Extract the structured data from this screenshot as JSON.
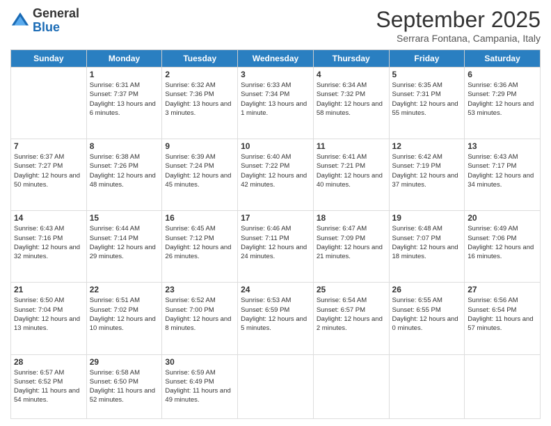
{
  "header": {
    "logo_general": "General",
    "logo_blue": "Blue",
    "month_title": "September 2025",
    "subtitle": "Serrara Fontana, Campania, Italy"
  },
  "days_of_week": [
    "Sunday",
    "Monday",
    "Tuesday",
    "Wednesday",
    "Thursday",
    "Friday",
    "Saturday"
  ],
  "weeks": [
    [
      {
        "day": "",
        "content": ""
      },
      {
        "day": "1",
        "content": "Sunrise: 6:31 AM\nSunset: 7:37 PM\nDaylight: 13 hours\nand 6 minutes."
      },
      {
        "day": "2",
        "content": "Sunrise: 6:32 AM\nSunset: 7:36 PM\nDaylight: 13 hours\nand 3 minutes."
      },
      {
        "day": "3",
        "content": "Sunrise: 6:33 AM\nSunset: 7:34 PM\nDaylight: 13 hours\nand 1 minute."
      },
      {
        "day": "4",
        "content": "Sunrise: 6:34 AM\nSunset: 7:32 PM\nDaylight: 12 hours\nand 58 minutes."
      },
      {
        "day": "5",
        "content": "Sunrise: 6:35 AM\nSunset: 7:31 PM\nDaylight: 12 hours\nand 55 minutes."
      },
      {
        "day": "6",
        "content": "Sunrise: 6:36 AM\nSunset: 7:29 PM\nDaylight: 12 hours\nand 53 minutes."
      }
    ],
    [
      {
        "day": "7",
        "content": "Sunrise: 6:37 AM\nSunset: 7:27 PM\nDaylight: 12 hours\nand 50 minutes."
      },
      {
        "day": "8",
        "content": "Sunrise: 6:38 AM\nSunset: 7:26 PM\nDaylight: 12 hours\nand 48 minutes."
      },
      {
        "day": "9",
        "content": "Sunrise: 6:39 AM\nSunset: 7:24 PM\nDaylight: 12 hours\nand 45 minutes."
      },
      {
        "day": "10",
        "content": "Sunrise: 6:40 AM\nSunset: 7:22 PM\nDaylight: 12 hours\nand 42 minutes."
      },
      {
        "day": "11",
        "content": "Sunrise: 6:41 AM\nSunset: 7:21 PM\nDaylight: 12 hours\nand 40 minutes."
      },
      {
        "day": "12",
        "content": "Sunrise: 6:42 AM\nSunset: 7:19 PM\nDaylight: 12 hours\nand 37 minutes."
      },
      {
        "day": "13",
        "content": "Sunrise: 6:43 AM\nSunset: 7:17 PM\nDaylight: 12 hours\nand 34 minutes."
      }
    ],
    [
      {
        "day": "14",
        "content": "Sunrise: 6:43 AM\nSunset: 7:16 PM\nDaylight: 12 hours\nand 32 minutes."
      },
      {
        "day": "15",
        "content": "Sunrise: 6:44 AM\nSunset: 7:14 PM\nDaylight: 12 hours\nand 29 minutes."
      },
      {
        "day": "16",
        "content": "Sunrise: 6:45 AM\nSunset: 7:12 PM\nDaylight: 12 hours\nand 26 minutes."
      },
      {
        "day": "17",
        "content": "Sunrise: 6:46 AM\nSunset: 7:11 PM\nDaylight: 12 hours\nand 24 minutes."
      },
      {
        "day": "18",
        "content": "Sunrise: 6:47 AM\nSunset: 7:09 PM\nDaylight: 12 hours\nand 21 minutes."
      },
      {
        "day": "19",
        "content": "Sunrise: 6:48 AM\nSunset: 7:07 PM\nDaylight: 12 hours\nand 18 minutes."
      },
      {
        "day": "20",
        "content": "Sunrise: 6:49 AM\nSunset: 7:06 PM\nDaylight: 12 hours\nand 16 minutes."
      }
    ],
    [
      {
        "day": "21",
        "content": "Sunrise: 6:50 AM\nSunset: 7:04 PM\nDaylight: 12 hours\nand 13 minutes."
      },
      {
        "day": "22",
        "content": "Sunrise: 6:51 AM\nSunset: 7:02 PM\nDaylight: 12 hours\nand 10 minutes."
      },
      {
        "day": "23",
        "content": "Sunrise: 6:52 AM\nSunset: 7:00 PM\nDaylight: 12 hours\nand 8 minutes."
      },
      {
        "day": "24",
        "content": "Sunrise: 6:53 AM\nSunset: 6:59 PM\nDaylight: 12 hours\nand 5 minutes."
      },
      {
        "day": "25",
        "content": "Sunrise: 6:54 AM\nSunset: 6:57 PM\nDaylight: 12 hours\nand 2 minutes."
      },
      {
        "day": "26",
        "content": "Sunrise: 6:55 AM\nSunset: 6:55 PM\nDaylight: 12 hours\nand 0 minutes."
      },
      {
        "day": "27",
        "content": "Sunrise: 6:56 AM\nSunset: 6:54 PM\nDaylight: 11 hours\nand 57 minutes."
      }
    ],
    [
      {
        "day": "28",
        "content": "Sunrise: 6:57 AM\nSunset: 6:52 PM\nDaylight: 11 hours\nand 54 minutes."
      },
      {
        "day": "29",
        "content": "Sunrise: 6:58 AM\nSunset: 6:50 PM\nDaylight: 11 hours\nand 52 minutes."
      },
      {
        "day": "30",
        "content": "Sunrise: 6:59 AM\nSunset: 6:49 PM\nDaylight: 11 hours\nand 49 minutes."
      },
      {
        "day": "",
        "content": ""
      },
      {
        "day": "",
        "content": ""
      },
      {
        "day": "",
        "content": ""
      },
      {
        "day": "",
        "content": ""
      }
    ]
  ]
}
